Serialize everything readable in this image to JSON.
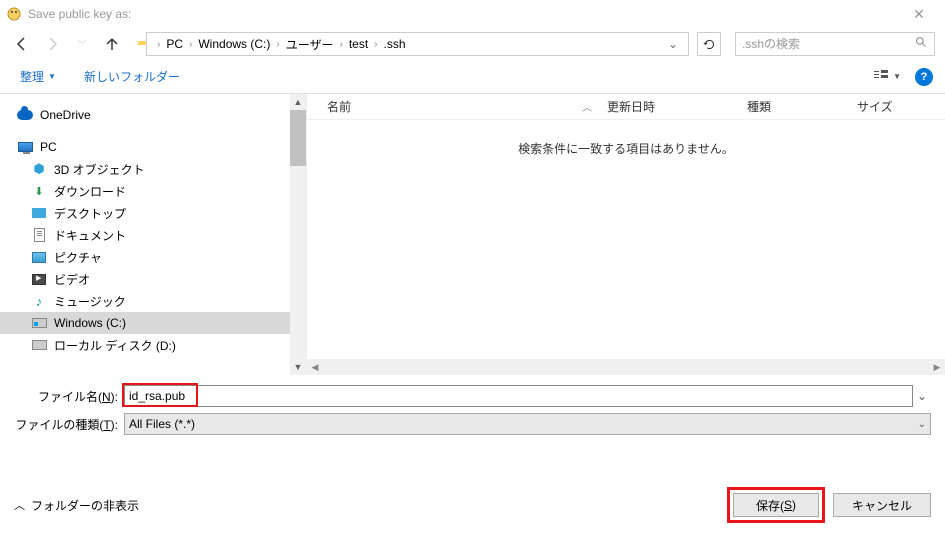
{
  "titlebar": {
    "title": "Save public key as:"
  },
  "breadcrumb": {
    "items": [
      "PC",
      "Windows (C:)",
      "ユーザー",
      "test",
      ".ssh"
    ]
  },
  "search": {
    "placeholder": ".sshの検索"
  },
  "toolbar": {
    "organize": "整理",
    "new_folder": "新しいフォルダー"
  },
  "sidebar": {
    "items": [
      {
        "label": "OneDrive",
        "type": "cloud"
      },
      {
        "label": "PC",
        "type": "pc"
      },
      {
        "label": "3D オブジェクト",
        "type": "3d",
        "indent": true
      },
      {
        "label": "ダウンロード",
        "type": "down",
        "indent": true
      },
      {
        "label": "デスクトップ",
        "type": "desk",
        "indent": true
      },
      {
        "label": "ドキュメント",
        "type": "doc",
        "indent": true
      },
      {
        "label": "ピクチャ",
        "type": "pic",
        "indent": true
      },
      {
        "label": "ビデオ",
        "type": "vid",
        "indent": true
      },
      {
        "label": "ミュージック",
        "type": "music",
        "indent": true
      },
      {
        "label": "Windows (C:)",
        "type": "drive-win",
        "indent": true,
        "selected": true
      },
      {
        "label": "ローカル ディスク (D:)",
        "type": "drive",
        "indent": true
      }
    ]
  },
  "columns": {
    "name": "名前",
    "date": "更新日時",
    "type": "種類",
    "size": "サイズ"
  },
  "file_area": {
    "empty_msg": "検索条件に一致する項目はありません。"
  },
  "form": {
    "filename_label_prefix": "ファイル名(",
    "filename_label_key": "N",
    "filename_label_suffix": "):",
    "filename_value": "id_rsa.pub",
    "filetype_label_prefix": "ファイルの種類(",
    "filetype_label_key": "T",
    "filetype_label_suffix": "):",
    "filetype_value": "All Files (*.*)"
  },
  "footer": {
    "hide_folders": "フォルダーの非表示",
    "save_prefix": "保存(",
    "save_key": "S",
    "save_suffix": ")",
    "cancel": "キャンセル"
  }
}
